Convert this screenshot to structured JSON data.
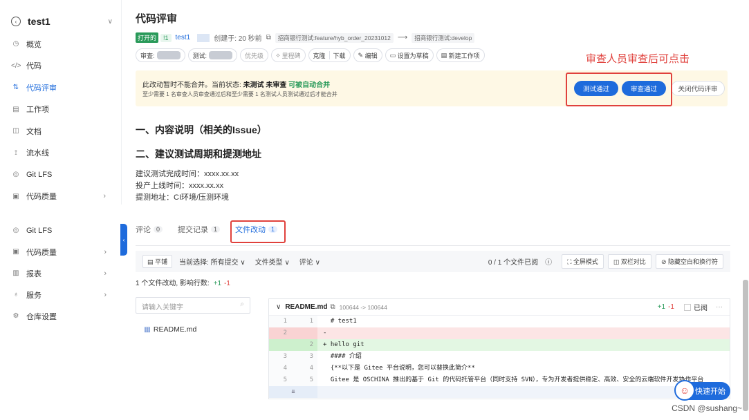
{
  "project": {
    "name": "test1"
  },
  "sidebar_top": [
    {
      "icon": "◷",
      "label": "概览"
    },
    {
      "icon": "</>",
      "label": "代码"
    },
    {
      "icon": "⇅",
      "label": "代码评审",
      "active": true
    },
    {
      "icon": "▤",
      "label": "工作项"
    },
    {
      "icon": "◫",
      "label": "文档"
    },
    {
      "icon": "⟟",
      "label": "流水线"
    },
    {
      "icon": "◎",
      "label": "Git LFS"
    },
    {
      "icon": "▣",
      "label": "代码质量",
      "arrow": "›"
    }
  ],
  "sidebar_bottom": [
    {
      "icon": "◎",
      "label": "Git LFS"
    },
    {
      "icon": "▣",
      "label": "代码质量",
      "arrow": "›"
    },
    {
      "icon": "▥",
      "label": "报表",
      "arrow": "›"
    },
    {
      "icon": "♁",
      "label": "服务",
      "arrow": "›"
    },
    {
      "icon": "⚙",
      "label": "仓库设置"
    }
  ],
  "pr": {
    "page_title": "代码评审",
    "status_badge": "打开的",
    "num_badge": "!1",
    "author": "test1",
    "created": "创建于: 20 秒前",
    "source_branch": "招商银行测试:feature/hyb_order_20231012",
    "arrow": "⟶",
    "target_branch": "招商银行测试:develop",
    "toolbar": [
      "审查:",
      "测试:",
      "优先级",
      "里程碑",
      "克隆",
      "下载",
      "编辑",
      "设置为草稿",
      "新建工作项"
    ]
  },
  "merge": {
    "line1_prefix": "此改动暂时不能合并。当前状态:",
    "untested": "未测试",
    "unreviewed": "未审查",
    "auto": "可被自动合并",
    "line2": "至少需要 1 名审查人员审查通过后和至少需要 1 名测试人员测试通过后才能合并",
    "test_pass": "测试通过",
    "review_pass": "审查通过",
    "close_review": "关闭代码评审"
  },
  "annotation": "审查人员审查后可点击",
  "description": {
    "h1": "一、内容说明（相关的Issue）",
    "h2": "二、建议测试周期和提测地址",
    "lines": [
      "建议测试完成时间：xxxx.xx.xx",
      "投产上线时间：xxxx.xx.xx",
      "提测地址：CI环境/压测环境"
    ]
  },
  "tabs": [
    {
      "label": "评论",
      "count": "0"
    },
    {
      "label": "提交记录",
      "count": "1"
    },
    {
      "label": "文件改动",
      "count": "1",
      "active": true
    }
  ],
  "filter": {
    "flat": "平铺",
    "current": "当前选择: 所有提交 ∨",
    "file_type": "文件类型 ∨",
    "comment": "评论 ∨",
    "viewed": "0 / 1 个文件已阅",
    "fullscreen": "全屏模式",
    "split": "双栏对比",
    "hide_ws": "隐藏空白和换行符"
  },
  "summary": {
    "text": "1 个文件改动, 影响行数:",
    "add": "+1",
    "del": "-1"
  },
  "search_placeholder": "请输入关键字",
  "file_tree": [
    "README.md"
  ],
  "diff": {
    "filename": "README.md",
    "mode": "100644 -> 100644",
    "add": "+1",
    "del": "-1",
    "viewed": "已阅",
    "rows": [
      {
        "type": "ctx",
        "n1": "1",
        "n2": "1",
        "code": "  # test1"
      },
      {
        "type": "del",
        "n1": "2",
        "n2": "",
        "code": "-"
      },
      {
        "type": "add",
        "n1": "",
        "n2": "2",
        "code": "+ hello git"
      },
      {
        "type": "ctx",
        "n1": "3",
        "n2": "3",
        "code": "  #### 介绍"
      },
      {
        "type": "ctx",
        "n1": "4",
        "n2": "4",
        "code": "  {**以下是 Gitee 平台说明，您可以替换此简介**"
      },
      {
        "type": "ctx",
        "n1": "5",
        "n2": "5",
        "code": "  Gitee 是 OSCHINA 推出的基于 Git 的代码托管平台（同时支持 SVN），专为开发者提供稳定、高效、安全的云端软件开发协作平台"
      }
    ]
  },
  "quick_start": "快速开始",
  "watermark": "CSDN @sushang~"
}
